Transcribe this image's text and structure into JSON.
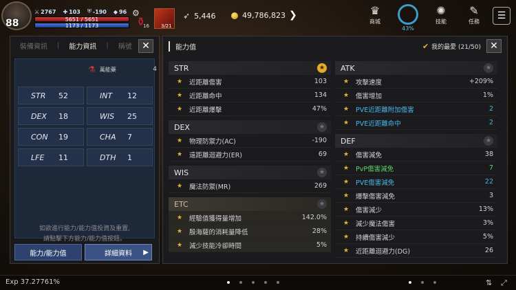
{
  "hud": {
    "level": "88",
    "stats": [
      "2767",
      "103",
      "-190",
      "96"
    ],
    "hp_text": "5651 / 5651",
    "hp_fraction": 1.0,
    "mp_text": "1173 / 1173",
    "mp_fraction": 1.0,
    "potion_count": "16",
    "hot_item_count": "3/21",
    "resource_a": "5,446",
    "resource_b": "49,786,823",
    "menu": [
      {
        "label": "商城",
        "icon": "shop-icon"
      },
      {
        "label": "",
        "icon": "gauge-icon",
        "percent": "43%"
      },
      {
        "label": "技能",
        "icon": "skill-icon"
      },
      {
        "label": "任務",
        "icon": "quest-icon"
      }
    ]
  },
  "left_panel": {
    "tabs": [
      "裝備資訊",
      "能力資訊",
      "稱號"
    ],
    "potion_label": "萬能藥",
    "potion_count": "4",
    "stats": [
      {
        "name": "STR",
        "value": "52"
      },
      {
        "name": "INT",
        "value": "12"
      },
      {
        "name": "DEX",
        "value": "18"
      },
      {
        "name": "WIS",
        "value": "25"
      },
      {
        "name": "CON",
        "value": "19"
      },
      {
        "name": "CHA",
        "value": "7"
      },
      {
        "name": "LFE",
        "value": "11"
      },
      {
        "name": "DTH",
        "value": "1"
      }
    ],
    "note_line1": "如欲進行能力/能力值投資及重置,",
    "note_line2": "請點擊下方能力/能力值按鈕。",
    "button_ability": "能力/能力值",
    "button_detail": "詳細資料"
  },
  "right_panel": {
    "title": "能力值",
    "favorite_label": "我的最愛 (21/50)",
    "left_sections": [
      {
        "name": "STR",
        "starred": true,
        "rows": [
          {
            "label": "近距離傷害",
            "value": "103"
          },
          {
            "label": "近距離命中",
            "value": "134"
          },
          {
            "label": "近距離爆擊",
            "value": "47%"
          }
        ]
      },
      {
        "name": "DEX",
        "starred": false,
        "rows": [
          {
            "label": "物理防禦力(AC)",
            "value": "-190"
          },
          {
            "label": "遠距離迴避力(ER)",
            "value": "69"
          }
        ]
      },
      {
        "name": "WIS",
        "starred": false,
        "rows": [
          {
            "label": "魔法防禦(MR)",
            "value": "269"
          }
        ]
      },
      {
        "name": "ETC",
        "starred": false,
        "rows": [
          {
            "label": "經驗值獲得量增加",
            "value": "142.0%"
          },
          {
            "label": "殷海薩的消耗量降低",
            "value": "28%"
          },
          {
            "label": "減少技能冷卻時間",
            "value": "5%"
          }
        ]
      }
    ],
    "right_sections": [
      {
        "name": "ATK",
        "starred": false,
        "rows": [
          {
            "label": "攻擊速度",
            "value": "+209%",
            "color": ""
          },
          {
            "label": "傷害增加",
            "value": "1%",
            "color": ""
          },
          {
            "label": "PVE近距離附加傷害",
            "value": "2",
            "color": "blue"
          },
          {
            "label": "PVE近距離命中",
            "value": "2",
            "color": "blue"
          }
        ]
      },
      {
        "name": "DEF",
        "starred": false,
        "rows": [
          {
            "label": "傷害減免",
            "value": "38",
            "color": ""
          },
          {
            "label": "PvP傷害減免",
            "value": "7",
            "color": "green"
          },
          {
            "label": "PVE傷害減免",
            "value": "22",
            "color": "blue"
          },
          {
            "label": "爆擊傷害減免",
            "value": "3",
            "color": ""
          },
          {
            "label": "傷害減少",
            "value": "13%",
            "color": ""
          },
          {
            "label": "減少魔法傷害",
            "value": "3%",
            "color": ""
          },
          {
            "label": "持續傷害減少",
            "value": "5%",
            "color": ""
          },
          {
            "label": "近距離迴避力(DG)",
            "value": "26",
            "color": ""
          }
        ]
      }
    ]
  },
  "bottom": {
    "exp": "Exp 37.27761%"
  }
}
